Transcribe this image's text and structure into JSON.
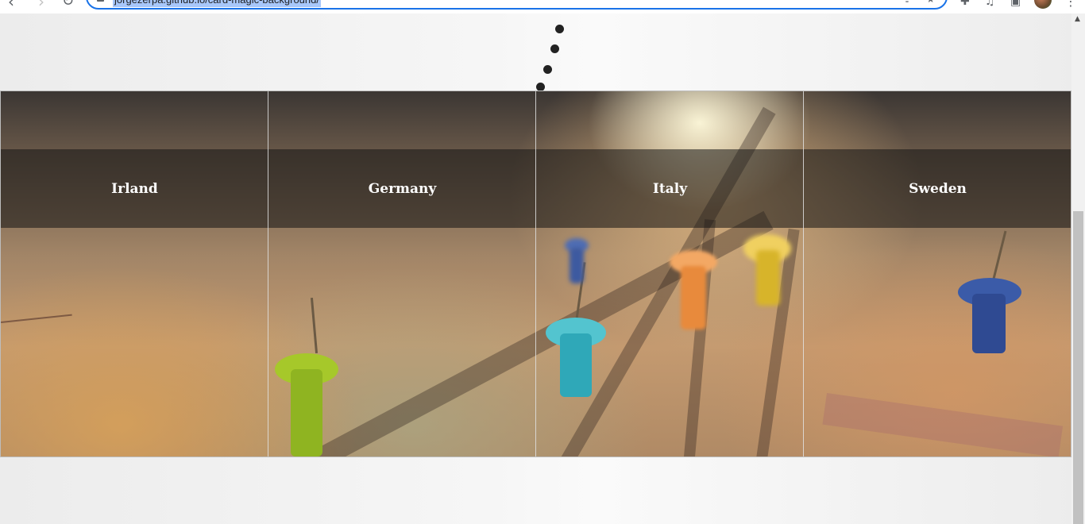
{
  "browser": {
    "url": "jorgezerpa.github.io/card-magic-background/",
    "icons": [
      "back-arrow-icon",
      "forward-arrow-icon",
      "reload-icon",
      "lock-icon",
      "share-icon",
      "star-icon",
      "puzzle-icon",
      "media-control-icon",
      "window-icon",
      "avatar",
      "menu-dots-icon"
    ]
  },
  "cards": [
    {
      "label": "Irland"
    },
    {
      "label": "Germany"
    },
    {
      "label": "Italy"
    },
    {
      "label": "Sweden"
    }
  ],
  "colors": {
    "overlay_band": "#141414",
    "card_text": "#ffffff",
    "loader_dots": "#222222",
    "omnibox_focus": "#1a73e8"
  }
}
